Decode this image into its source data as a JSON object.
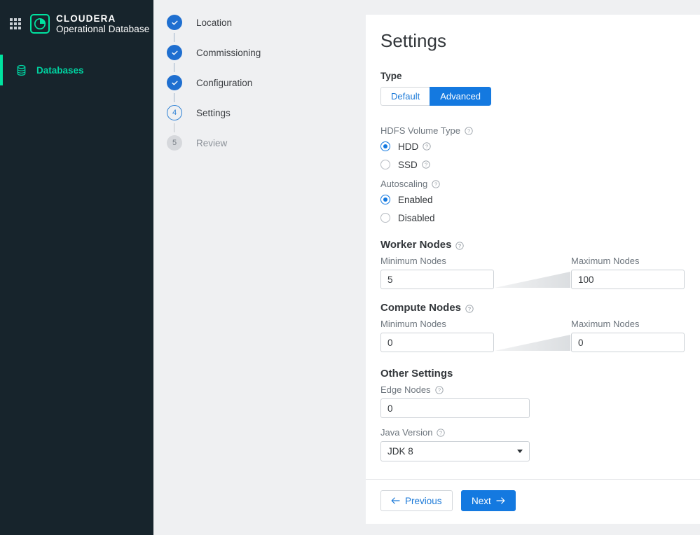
{
  "sidebar": {
    "apps_icon": "grid-apps-icon",
    "logo_icon": "cloudera-pie-logo-icon",
    "brand_top": "CLOUDERA",
    "brand_bottom": "Operational Database",
    "nav": [
      {
        "label": "Databases",
        "icon": "database-icon",
        "active": true
      }
    ]
  },
  "stepper": {
    "steps": [
      {
        "num": "1",
        "label": "Location",
        "state": "done"
      },
      {
        "num": "2",
        "label": "Commissioning",
        "state": "done"
      },
      {
        "num": "3",
        "label": "Configuration",
        "state": "done"
      },
      {
        "num": "4",
        "label": "Settings",
        "state": "current"
      },
      {
        "num": "5",
        "label": "Review",
        "state": "pending"
      }
    ]
  },
  "page": {
    "title": "Settings"
  },
  "type_section": {
    "heading": "Type",
    "options": [
      {
        "label": "Default",
        "selected": false
      },
      {
        "label": "Advanced",
        "selected": true
      }
    ]
  },
  "hdfs": {
    "label": "HDFS Volume Type",
    "help_icon": "help-circle-icon",
    "options": [
      {
        "label": "HDD",
        "checked": true,
        "help_icon": "help-circle-icon"
      },
      {
        "label": "SSD",
        "checked": false,
        "help_icon": "help-circle-icon"
      }
    ]
  },
  "autoscaling": {
    "label": "Autoscaling",
    "help_icon": "help-circle-icon",
    "options": [
      {
        "label": "Enabled",
        "checked": true
      },
      {
        "label": "Disabled",
        "checked": false
      }
    ]
  },
  "worker_nodes": {
    "heading": "Worker Nodes",
    "help_icon": "help-circle-icon",
    "min_label": "Minimum Nodes",
    "min_value": "5",
    "max_label": "Maximum Nodes",
    "max_value": "100"
  },
  "compute_nodes": {
    "heading": "Compute Nodes",
    "help_icon": "help-circle-icon",
    "min_label": "Minimum Nodes",
    "min_value": "0",
    "max_label": "Maximum Nodes",
    "max_value": "0"
  },
  "other_settings": {
    "heading": "Other Settings",
    "edge_nodes": {
      "label": "Edge Nodes",
      "help_icon": "help-circle-icon",
      "value": "0"
    },
    "java_version": {
      "label": "Java Version",
      "help_icon": "help-circle-icon",
      "value": "JDK 8",
      "caret_icon": "chevron-down-icon"
    }
  },
  "footer": {
    "previous_label": "Previous",
    "previous_icon": "arrow-left-icon",
    "next_label": "Next",
    "next_icon": "arrow-right-icon"
  },
  "colors": {
    "sidebar_bg": "#17242C",
    "accent_teal": "#00E3A0",
    "primary_blue": "#1479E0",
    "step_done_blue": "#1F6FD0",
    "page_bg": "#EFF0F2"
  }
}
